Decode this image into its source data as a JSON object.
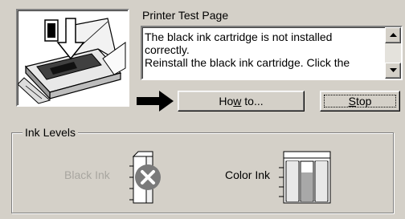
{
  "window": {
    "title": "Printer Test Page"
  },
  "illustration": {
    "icon": "printer-install-cartridge-icon"
  },
  "message": {
    "text": "The black ink cartridge is not installed correctly.\nReinstall the black ink cartridge. Click the"
  },
  "scrollbar": {
    "up_icon": "arrow-up-icon",
    "down_icon": "arrow-down-icon"
  },
  "buttons": {
    "howto_pre": "Ho",
    "howto_ul": "w",
    "howto_post": " to...",
    "stop_ul": "S",
    "stop_post": "top"
  },
  "ink_levels": {
    "group_label": "Ink Levels",
    "black": {
      "label": "Black Ink",
      "status_icon": "error-x-icon",
      "level": 0
    },
    "color": {
      "label": "Color Ink",
      "cartridges": [
        "cyan",
        "magenta",
        "yellow"
      ],
      "levels": [
        1.0,
        0.72,
        1.0
      ]
    }
  },
  "colors": {
    "face": "#d4d0c8",
    "disabled_text": "#a8a6a0",
    "error_icon": "#7a7a7a"
  }
}
